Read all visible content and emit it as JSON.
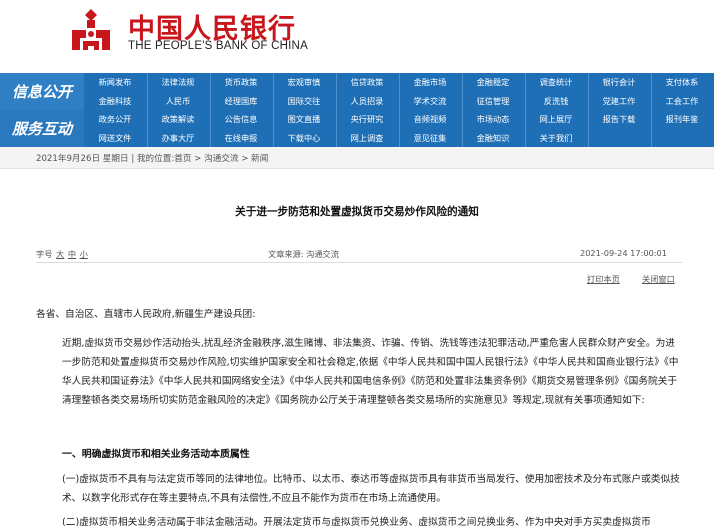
{
  "header": {
    "logo_cn": "中国人民银行",
    "logo_en": "THE PEOPLE'S BANK OF CHINA",
    "colors": {
      "brand_red": "#c8161d",
      "nav_blue": "#1f6fb6"
    }
  },
  "nav": {
    "section1_label": "信息公开",
    "section2_label": "服务互动",
    "rows": [
      [
        "新闻发布",
        "法律法规",
        "货币政策",
        "宏观审慎",
        "信贷政策",
        "金融市场",
        "金融稳定",
        "调查统计",
        "银行会计",
        "支付体系"
      ],
      [
        "金融科技",
        "人民币",
        "经理国库",
        "国际交往",
        "人员招录",
        "学术交流",
        "征信管理",
        "反洗钱",
        "党建工作",
        "工会工作"
      ],
      [
        "政务公开",
        "政策解读",
        "公告信息",
        "图文直播",
        "央行研究",
        "音频视频",
        "市场动态",
        "网上展厅",
        "报告下载",
        "报刊年鉴"
      ],
      [
        "网送文件",
        "办事大厅",
        "在线申报",
        "下载中心",
        "网上调查",
        "意见征集",
        "金融知识",
        "关于我们",
        "",
        ""
      ]
    ]
  },
  "breadcrumb": {
    "date": "2021年9月26日 星期日",
    "separator": "|",
    "prefix": "我的位置:",
    "path": [
      "首页",
      "沟通交流",
      "新闻"
    ],
    "path_sep": ">"
  },
  "article": {
    "title": "关于进一步防范和处置虚拟货币交易炒作风险的通知",
    "font_size_label": "字号",
    "font_sizes": [
      "大",
      "中",
      "小"
    ],
    "source_label": "文章来源:",
    "source": "沟通交流",
    "datetime": "2021-09-24 17:00:01",
    "print_label": "打印本页",
    "close_label": "关闭窗口",
    "addressee": "各省、自治区、直辖市人民政府,新疆生产建设兵团:",
    "para1": "近期,虚拟货币交易炒作活动抬头,扰乱经济金融秩序,滋生赌博、非法集资、诈骗、传销、洗钱等违法犯罪活动,严重危害人民群众财产安全。为进一步防范和处置虚拟货币交易炒作风险,切实维护国家安全和社会稳定,依据《中华人民共和国中国人民银行法》《中华人民共和国商业银行法》《中华人民共和国证券法》《中华人民共和国网络安全法》《中华人民共和国电信条例》《防范和处置非法集资条例》《期货交易管理条例》《国务院关于清理整顿各类交易场所切实防范金融风险的决定》《国务院办公厅关于清理整顿各类交易场所的实施意见》等规定,现就有关事项通知如下:",
    "section1_heading": "一、明确虚拟货币和相关业务活动本质属性",
    "para2": "(一)虚拟货币不具有与法定货币等同的法律地位。比特币、以太币、泰达币等虚拟货币具有非货币当局发行、使用加密技术及分布式账户或类似技术、以数字化形式存在等主要特点,不具有法偿性,不应且不能作为货币在市场上流通使用。",
    "para3": "(二)虚拟货币相关业务活动属于非法金融活动。开展法定货币与虚拟货币兑换业务、虚拟货币之间兑换业务、作为中央对手方买卖虚拟货币"
  }
}
